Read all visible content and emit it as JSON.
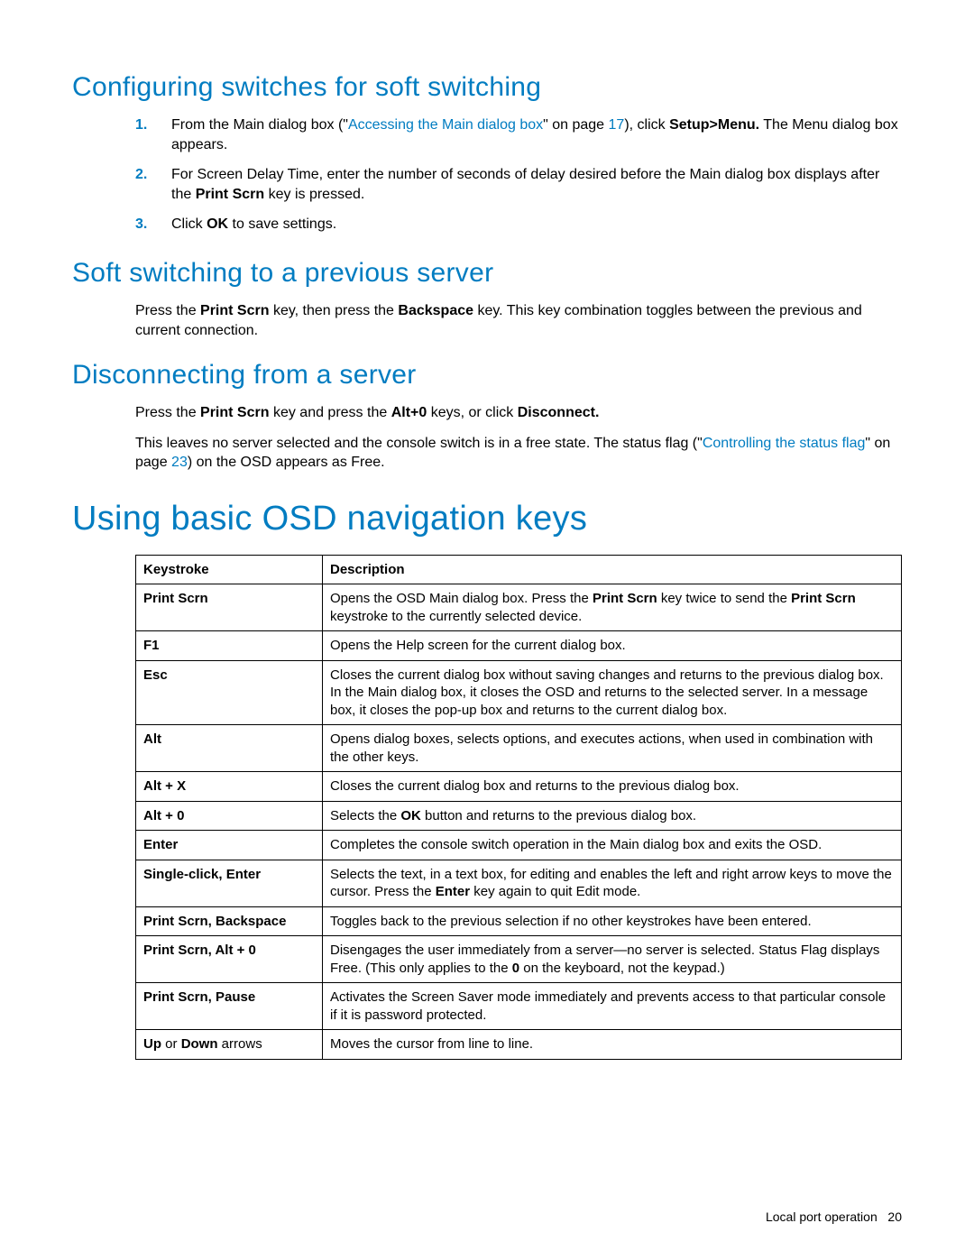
{
  "sections": {
    "configuring": {
      "title": "Configuring switches for soft switching",
      "step1_a": "From the Main dialog box (\"",
      "step1_link": "Accessing the Main dialog box",
      "step1_b": "\" on page ",
      "step1_page": "17",
      "step1_c": "), click ",
      "step1_bold": "Setup>Menu.",
      "step1_d": " The Menu dialog box appears.",
      "step2_a": "For Screen Delay Time, enter the number of seconds of delay desired before the Main dialog box displays after the ",
      "step2_bold": "Print Scrn",
      "step2_b": " key is pressed.",
      "step3_a": "Click ",
      "step3_bold": "OK",
      "step3_b": " to save settings."
    },
    "softswitch": {
      "title": "Soft switching to a previous server",
      "p_a": "Press the ",
      "p_b1": "Print Scrn",
      "p_b": " key, then press the ",
      "p_b2": "Backspace",
      "p_c": " key. This key combination toggles between the previous and current connection."
    },
    "disconnect": {
      "title": "Disconnecting from a server",
      "p1_a": "Press the ",
      "p1_b1": "Print Scrn",
      "p1_b": " key and press the ",
      "p1_b2": "Alt+0",
      "p1_c": " keys, or click ",
      "p1_b3": "Disconnect.",
      "p2_a": "This leaves no server selected and the console switch is in a free state. The status flag (\"",
      "p2_link": "Controlling the status flag",
      "p2_b": "\" on page ",
      "p2_page": "23",
      "p2_c": ") on the OSD appears as Free."
    },
    "osdnav": {
      "title": "Using basic OSD navigation keys"
    }
  },
  "table": {
    "head_key": "Keystroke",
    "head_desc": "Description",
    "rows": [
      {
        "key": "Print Scrn",
        "desc_a": "Opens the OSD Main dialog box. Press the ",
        "desc_b1": "Print Scrn",
        "desc_b": " key twice to send the ",
        "desc_b2": "Print Scrn",
        "desc_c": " keystroke to the currently selected device."
      },
      {
        "key": "F1",
        "desc": "Opens the Help screen for the current dialog box."
      },
      {
        "key": "Esc",
        "desc": "Closes the current dialog box without saving changes and returns to the previous dialog box. In the Main dialog box, it closes the OSD and returns to the selected server. In a message box, it closes the pop-up box and returns to the current dialog box."
      },
      {
        "key": "Alt",
        "desc": "Opens dialog boxes, selects options, and executes actions, when used in combination with the other keys."
      },
      {
        "key": "Alt + X",
        "desc": "Closes the current dialog box and returns to the previous dialog box."
      },
      {
        "key": "Alt + 0",
        "desc_a": "Selects the ",
        "desc_b1": "OK",
        "desc_b": " button and returns to the previous dialog box."
      },
      {
        "key": "Enter",
        "desc": "Completes the console switch operation in the Main dialog box and exits the OSD."
      },
      {
        "key": "Single-click, Enter",
        "desc_a": "Selects the text, in a text box, for editing and enables the left and right arrow keys to move the cursor. Press the ",
        "desc_b1": "Enter",
        "desc_b": " key again to quit Edit mode."
      },
      {
        "key": "Print Scrn, Backspace",
        "desc": "Toggles back to the previous selection if no other keystrokes have been entered."
      },
      {
        "key": "Print Scrn, Alt + 0",
        "desc_a": "Disengages the user immediately from a server—no server is selected. Status Flag displays Free. (This only applies to the ",
        "desc_b1": "0",
        "desc_b": " on the keyboard, not the keypad.)"
      },
      {
        "key": "Print Scrn, Pause",
        "desc": "Activates the Screen Saver mode immediately and prevents access to that particular console if it is password protected."
      },
      {
        "key_a": "Up",
        "key_mid": " or ",
        "key_b": "Down",
        "key_c": " arrows",
        "desc": "Moves the cursor from line to line."
      }
    ]
  },
  "footer": {
    "label": "Local port operation",
    "page": "20"
  }
}
